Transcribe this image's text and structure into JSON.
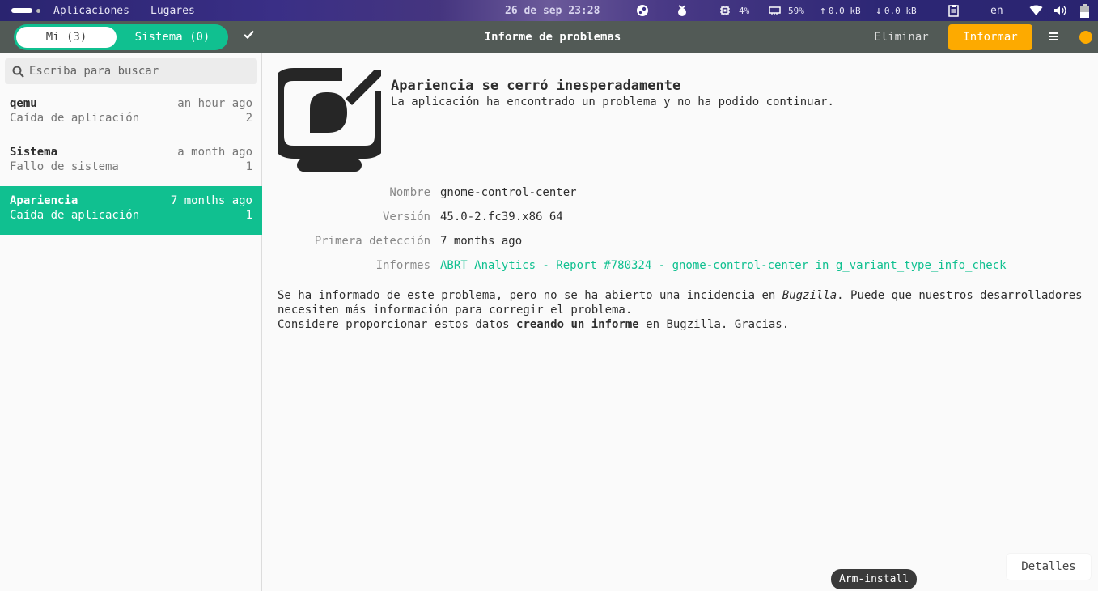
{
  "panel": {
    "apps_label": "Aplicaciones",
    "places_label": "Lugares",
    "clock": "26 de sep 23:28",
    "cpu": "4%",
    "memory": "59%",
    "net_up": "0.0 kB",
    "net_down": "0.0 kB",
    "lang": "en"
  },
  "header": {
    "tab_mine": "Mi (3)",
    "tab_system": "Sistema (0)",
    "title": "Informe de problemas",
    "delete_label": "Eliminar",
    "report_label": "Informar",
    "accent": "#10c090",
    "report_color": "#fdaa00"
  },
  "sidebar": {
    "search_placeholder": "Escriba para buscar",
    "items": [
      {
        "name": "qemu",
        "when": "an hour ago",
        "type": "Caída de aplicación",
        "count": "2"
      },
      {
        "name": "Sistema",
        "when": "a month ago",
        "type": "Fallo de sistema",
        "count": "1"
      },
      {
        "name": "Apariencia",
        "when": "7 months ago",
        "type": "Caída de aplicación",
        "count": "1"
      }
    ]
  },
  "problem": {
    "title": "Apariencia se cerró inesperadamente",
    "subtitle": "La aplicación ha encontrado un problema y no ha podido continuar.",
    "fields": {
      "name_label": "Nombre",
      "name_value": "gnome-control-center",
      "version_label": "Versión",
      "version_value": "45.0-2.fc39.x86_64",
      "first_label": "Primera detección",
      "first_value": "7 months ago",
      "reports_label": "Informes",
      "reports_value": "ABRT Analytics - Report #780324 - gnome-control-center in g_variant_type_info_check"
    },
    "para_1a": "Se ha informado de este problema, pero no se ha abierto una incidencia en ",
    "para_1_em": "Bugzilla",
    "para_1b": ". Puede que nuestros desarrolladores necesiten más información para corregir el problema.",
    "para_2a": "Considere proporcionar estos datos ",
    "para_2_strong": "creando un informe",
    "para_2b": " en Bugzilla. Gracias.",
    "details_label": "Detalles"
  },
  "tooltip": "Arm-install"
}
